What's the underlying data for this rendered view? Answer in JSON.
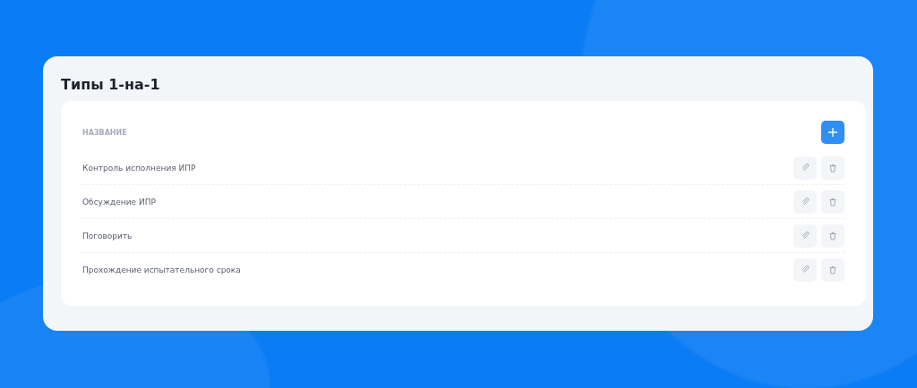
{
  "title": "Типы 1-на-1",
  "table": {
    "columns": [
      "НАЗВАНИЕ"
    ],
    "rows": [
      {
        "name": "Контроль исполнения ИПР"
      },
      {
        "name": "Обсуждение ИПР"
      },
      {
        "name": "Поговорить"
      },
      {
        "name": "Прохождение испытательного срока"
      }
    ]
  }
}
